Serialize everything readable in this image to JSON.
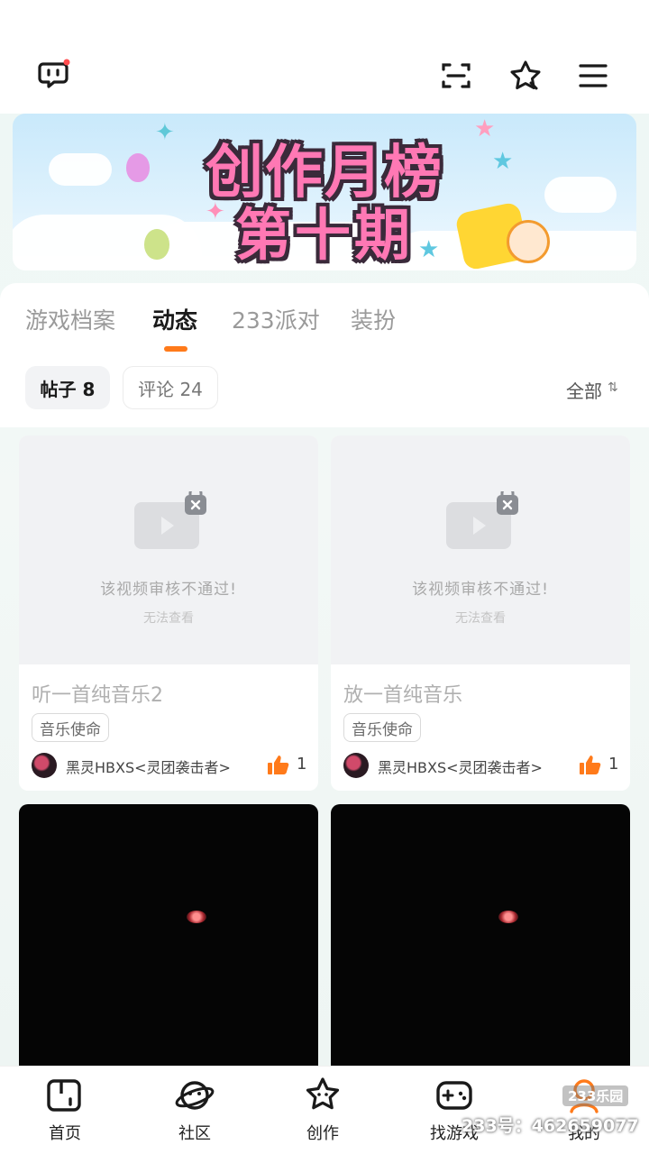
{
  "header": {
    "chat_icon": "chat-bubble-icon",
    "scan_icon": "scan-icon",
    "star_icon": "star-icon",
    "menu_icon": "menu-icon",
    "notification_dot_color": "#ff4d4f"
  },
  "banner": {
    "line1": "创作月榜",
    "line2": "第十期"
  },
  "tabs": [
    {
      "label": "游戏档案",
      "active": false
    },
    {
      "label": "动态",
      "active": true
    },
    {
      "label": "233派对",
      "active": false
    },
    {
      "label": "装扮",
      "active": false
    }
  ],
  "filters": {
    "posts_label": "帖子 8",
    "comments_label": "评论 24",
    "all_label": "全部",
    "sort_glyph": "⇅"
  },
  "cards": [
    {
      "blocked_title": "该视频审核不通过!",
      "blocked_sub": "无法查看",
      "title": "听一首纯音乐2",
      "tag": "音乐使命",
      "author": "黑灵HBXS<灵团袭击者>",
      "likes": "1"
    },
    {
      "blocked_title": "该视频审核不通过!",
      "blocked_sub": "无法查看",
      "title": "放一首纯音乐",
      "tag": "音乐使命",
      "author": "黑灵HBXS<灵团袭击者>",
      "likes": "1"
    }
  ],
  "bottom_nav": [
    {
      "label": "首页",
      "icon": "home-icon"
    },
    {
      "label": "社区",
      "icon": "planet-icon"
    },
    {
      "label": "创作",
      "icon": "create-star-icon"
    },
    {
      "label": "找游戏",
      "icon": "gamepad-icon"
    },
    {
      "label": "我的",
      "icon": "profile-icon"
    }
  ],
  "watermark": {
    "logo": "233乐园",
    "text": "233号：462659077"
  },
  "colors": {
    "accent": "#ff7a1a",
    "like": "#ff7a1a",
    "banner_text": "#ff78b4"
  }
}
